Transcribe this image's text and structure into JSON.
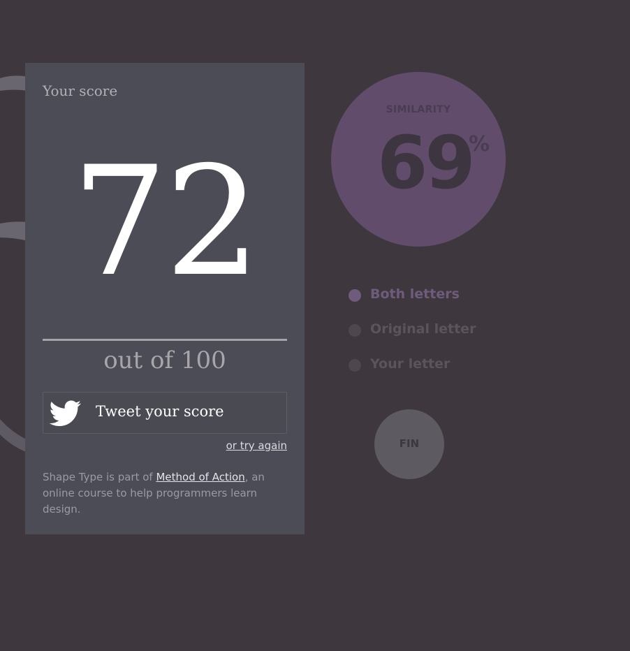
{
  "score_card": {
    "heading": "Your score",
    "score": "72",
    "out_of": "out of 100",
    "tweet_label": "Tweet your score",
    "try_again": "or try again",
    "footer_prefix": "Shape Type is part of ",
    "footer_link": "Method of Action",
    "footer_suffix": ", an online course to help programmers learn design."
  },
  "similarity": {
    "label": "SIMILARITY",
    "value": "69",
    "unit": "%"
  },
  "legend": {
    "items": [
      {
        "label": "Both letters",
        "active": true
      },
      {
        "label": "Original letter",
        "active": false
      },
      {
        "label": "Your letter",
        "active": false
      }
    ]
  },
  "fin_button": {
    "label": "FIN"
  },
  "colors": {
    "background": "#3e383e",
    "card": "#4c4c56",
    "accent_purple": "#614d6b",
    "active_legend": "#6f5b7b"
  },
  "icons": {
    "tweet": "twitter-bird-icon"
  }
}
